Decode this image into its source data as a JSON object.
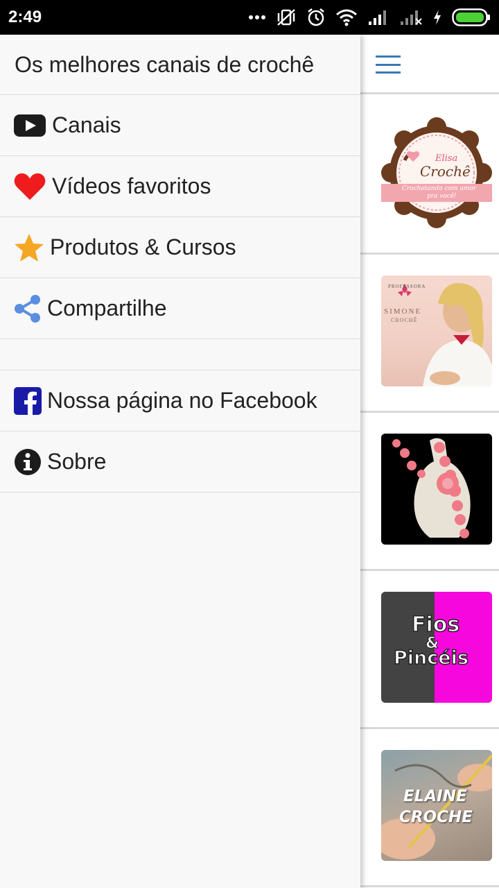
{
  "status_bar": {
    "time": "2:49",
    "icons": [
      "more-dots-icon",
      "vibrate-off-icon",
      "alarm-icon",
      "wifi-icon",
      "signal-icon",
      "signal-no-service-icon",
      "charging-icon",
      "battery-icon"
    ]
  },
  "drawer": {
    "title": "Os melhores canais de crochê",
    "items": [
      {
        "label": "Canais",
        "icon": "youtube-play-icon"
      },
      {
        "label": "Vídeos favoritos",
        "icon": "heart-icon",
        "color": "#ee1c1c"
      },
      {
        "label": "Produtos & Cursos",
        "icon": "star-icon",
        "color": "#f5a623"
      },
      {
        "label": "Compartilhe",
        "icon": "share-icon",
        "color": "#5b8ee0"
      }
    ],
    "secondary_items": [
      {
        "label": "Nossa página no Facebook",
        "icon": "facebook-icon",
        "color": "#1a1aa8"
      },
      {
        "label": "Sobre",
        "icon": "info-icon"
      }
    ]
  },
  "main": {
    "menu_icon": "hamburger-menu-icon",
    "accent": "#3b78b4",
    "channels": [
      {
        "thumb_text": [
          "Elisa",
          "Crochê",
          "Crochetando com amor",
          "pra você!"
        ]
      },
      {
        "thumb_text": [
          "PROFESSORA",
          "SIMONE",
          "CROCHÊ"
        ]
      },
      {
        "thumb_text": []
      },
      {
        "thumb_text": [
          "Fios",
          "&",
          "Pincéis"
        ]
      },
      {
        "thumb_text": [
          "ELAINE",
          "CROCHE"
        ]
      }
    ]
  }
}
